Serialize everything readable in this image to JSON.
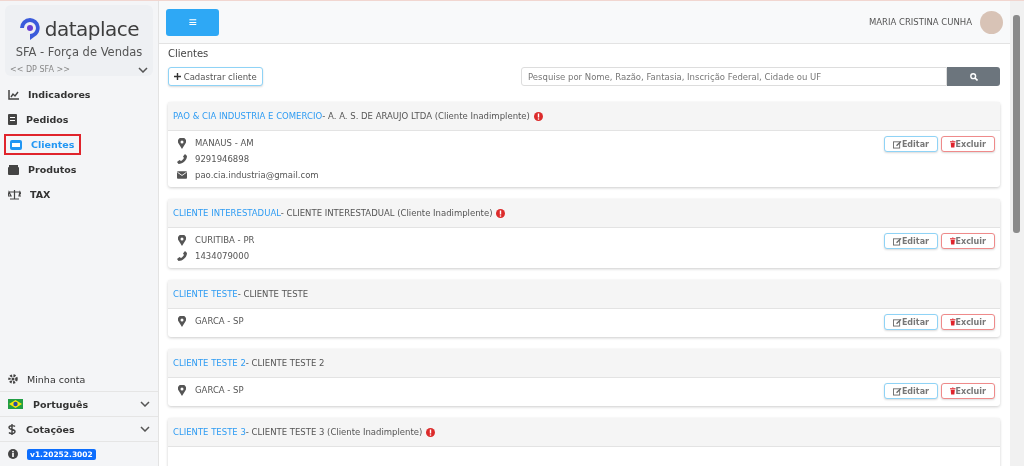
{
  "sidebar": {
    "logo_text": "dataplace",
    "app_title": "SFA - Força de Vendas",
    "company": "<< DP SFA >>",
    "items": [
      {
        "label": "Indicadores",
        "selected": false
      },
      {
        "label": "Pedidos",
        "selected": false
      },
      {
        "label": "Clientes",
        "selected": true
      },
      {
        "label": "Produtos",
        "selected": false
      },
      {
        "label": "TAX",
        "selected": false
      }
    ],
    "bottom": [
      {
        "kind": "link",
        "label": "Minha conta"
      },
      {
        "kind": "dropdown",
        "label": "Português"
      },
      {
        "kind": "dropdown",
        "label": "Cotações"
      },
      {
        "kind": "version",
        "label": "v1.20252.3002"
      }
    ]
  },
  "topbar": {
    "menu_glyph": "≡",
    "user_name": "MARIA CRISTINA CUNHA"
  },
  "page": {
    "title": "Clientes",
    "add_button": "Cadastrar cliente",
    "search": {
      "placeholder": "Pesquise por Nome, Razão, Fantasia, Inscrição Federal, Cidade ou UF"
    }
  },
  "clients": [
    {
      "name": "PAO & CIA INDUSTRIA E COMERCIO",
      "detail": "- A. A. S. DE ARAUJO LTDA (Cliente Inadimplente)",
      "overdue": true,
      "lines": [
        {
          "kind": "location",
          "text": "MANAUS - AM"
        },
        {
          "kind": "phone",
          "text": "9291946898"
        },
        {
          "kind": "email",
          "text": "pao.cia.industria@gmail.com"
        }
      ],
      "buttons": [
        "Editar",
        "Excluir"
      ]
    },
    {
      "name": "CLIENTE INTERESTADUAL",
      "detail": "- CLIENTE INTERESTADUAL (Cliente Inadimplente)",
      "overdue": true,
      "lines": [
        {
          "kind": "location",
          "text": "CURITIBA - PR"
        },
        {
          "kind": "phone",
          "text": "1434079000"
        }
      ],
      "buttons": [
        "Editar",
        "Excluir"
      ]
    },
    {
      "name": "CLIENTE TESTE",
      "detail": "- CLIENTE TESTE",
      "overdue": false,
      "lines": [
        {
          "kind": "location",
          "text": "GARCA - SP"
        }
      ],
      "buttons": [
        "Editar",
        "Excluir"
      ]
    },
    {
      "name": "CLIENTE TESTE 2",
      "detail": "- CLIENTE TESTE 2",
      "overdue": false,
      "lines": [
        {
          "kind": "location",
          "text": "GARCA - SP"
        }
      ],
      "buttons": [
        "Editar",
        "Excluir"
      ]
    },
    {
      "name": "CLIENTE TESTE 3",
      "detail": "- CLIENTE TESTE 3 (Cliente Inadimplente)",
      "overdue": true
    }
  ]
}
